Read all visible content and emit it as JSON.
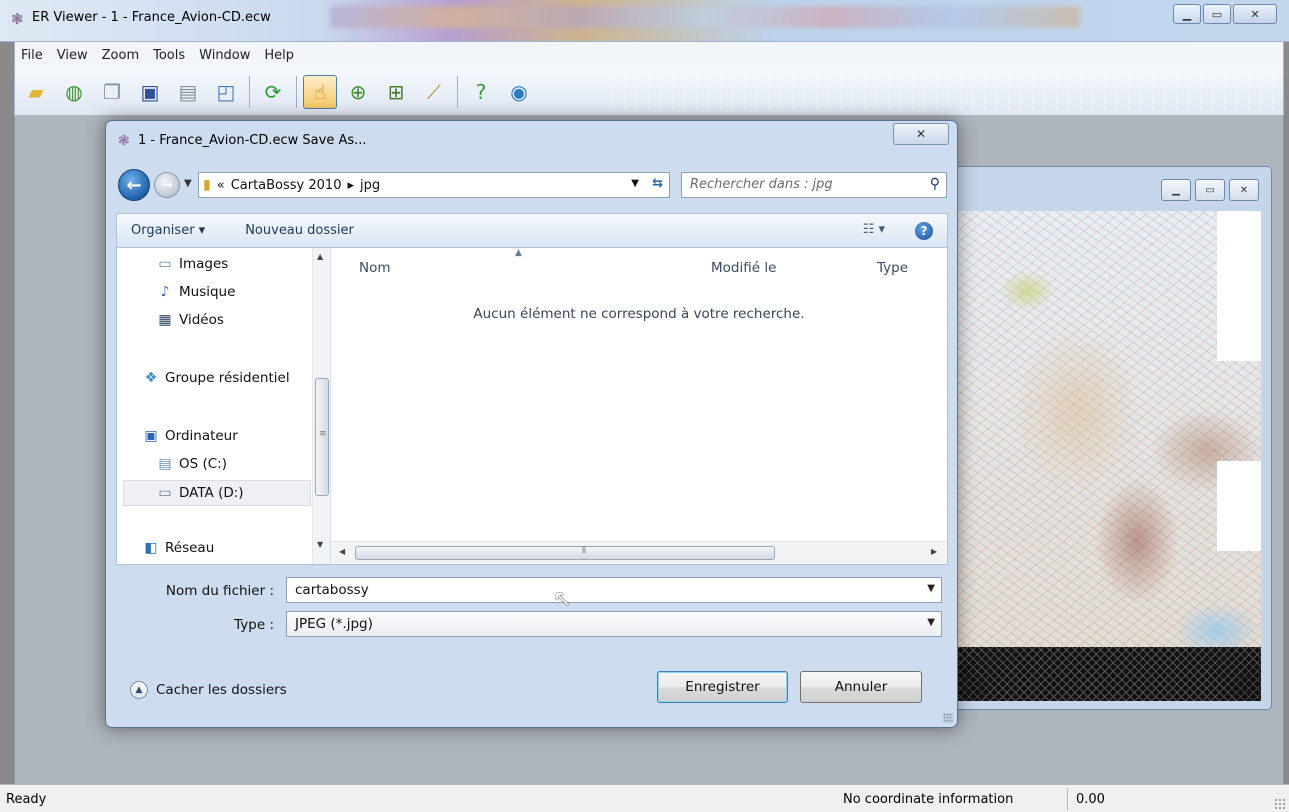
{
  "app": {
    "title": "ER Viewer - 1 - France_Avion-CD.ecw",
    "menu": [
      "File",
      "View",
      "Zoom",
      "Tools",
      "Window",
      "Help"
    ]
  },
  "toolbar": {
    "icons": [
      "open-folder-icon",
      "open-globe-icon",
      "copy-icon",
      "save-icon",
      "print-icon",
      "print-preview-icon",
      "refresh-icon",
      "pan-hand-icon",
      "zoom-in-icon",
      "zoom-box-icon",
      "measure-ruler-icon",
      "help-icon",
      "about-icon"
    ]
  },
  "dialog": {
    "title": "1 - France_Avion-CD.ecw Save As...",
    "address": {
      "prefix": "«",
      "crumbs": [
        "CartaBossy 2010",
        "jpg"
      ]
    },
    "search_placeholder": "Rechercher dans : jpg",
    "command_bar": {
      "organize": "Organiser ▾",
      "new_folder": "Nouveau dossier"
    },
    "nav_items": [
      "Images",
      "Musique",
      "Vidéos",
      "Groupe résidentiel",
      "Ordinateur",
      "OS (C:)",
      "DATA (D:)",
      "Réseau"
    ],
    "columns": [
      "Nom",
      "Modifié le",
      "Type"
    ],
    "empty_message": "Aucun élément ne correspond à votre recherche.",
    "file_name_label": "Nom du fichier :",
    "file_name_value": "cartabossy",
    "type_label": "Type :",
    "type_value": "JPEG  (*.jpg)",
    "hide_folders": "Cacher les dossiers",
    "save_button": "Enregistrer",
    "cancel_button": "Annuler"
  },
  "statusbar": {
    "ready": "Ready",
    "coord": "No coordinate information",
    "value": "0.00"
  },
  "colors": {
    "accent": "#1f5fa8",
    "dialog_bg": "#cddcef",
    "selection": "#eef0f3"
  }
}
